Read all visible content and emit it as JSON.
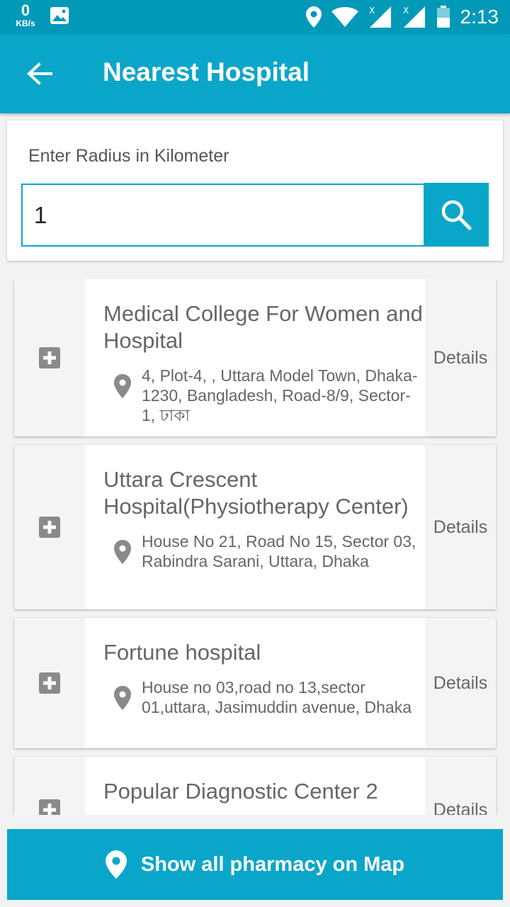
{
  "status_bar": {
    "speed_value": "0",
    "speed_unit": "KB/s",
    "time": "2:13"
  },
  "app_bar": {
    "title": "Nearest Hospital"
  },
  "radius": {
    "label": "Enter Radius in Kilometer",
    "value": "1"
  },
  "hospitals": [
    {
      "name": "Medical College For Women and Hospital",
      "address": "4, Plot-4, , Uttara Model Town, Dhaka-1230, Bangladesh, Road-8/9, Sector-1, ঢাকা",
      "details": "Details"
    },
    {
      "name": "Uttara Crescent Hospital(Physiotherapy Center)",
      "address": "House No 21, Road No 15, Sector 03, Rabindra Sarani, Uttara, Dhaka",
      "details": "Details"
    },
    {
      "name": "Fortune hospital",
      "address": "House no 03,road no 13,sector 01,uttara, Jasimuddin avenue, Dhaka",
      "details": "Details"
    },
    {
      "name": "Popular Diagnostic Center 2",
      "address": "",
      "details": "Details"
    }
  ],
  "map_button": {
    "label": "Show all pharmacy on Map"
  },
  "colors": {
    "primary": "#0aa6c9",
    "status_bar": "#0299b9",
    "icon_gray": "#8a8a8a"
  }
}
